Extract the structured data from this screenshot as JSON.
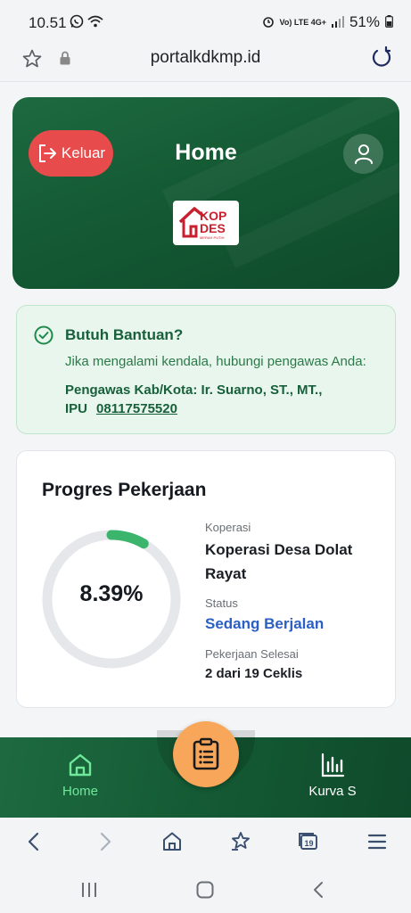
{
  "status_bar": {
    "time": "10.51",
    "signal_labels": "Vo) LTE  4G+",
    "battery": "51%"
  },
  "browser": {
    "url": "portalkdkmp.id"
  },
  "header": {
    "logout_label": "Keluar",
    "title": "Home",
    "logo_text_top": "KOP",
    "logo_text_bottom": "DES",
    "logo_subtext": "MERAH PUTIH"
  },
  "help": {
    "title": "Butuh Bantuan?",
    "description": "Jika mengalami kendala, hubungi pengawas Anda:",
    "supervisor": "Pengawas Kab/Kota: Ir. Suarno, ST., MT.,",
    "role": "IPU",
    "phone": "08117575520"
  },
  "progress": {
    "title": "Progres Pekerjaan",
    "percent_label": "8.39%",
    "percent_value": 8.39,
    "koperasi_label": "Koperasi",
    "koperasi_line1": "Koperasi Desa Dolat",
    "koperasi_line2": "Rayat",
    "status_label": "Status",
    "status_value": "Sedang Berjalan",
    "done_label": "Pekerjaan Selesai",
    "done_value": "2 dari 19 Ceklis"
  },
  "bottom_nav": {
    "home_label": "Home",
    "kurva_label": "Kurva S"
  },
  "colors": {
    "primary_green": "#145a34",
    "accent_green": "#6fe89a",
    "danger": "#e84b4b",
    "fab": "#f7a65a",
    "status_blue": "#2a5fc4"
  },
  "tabs_count": "19"
}
